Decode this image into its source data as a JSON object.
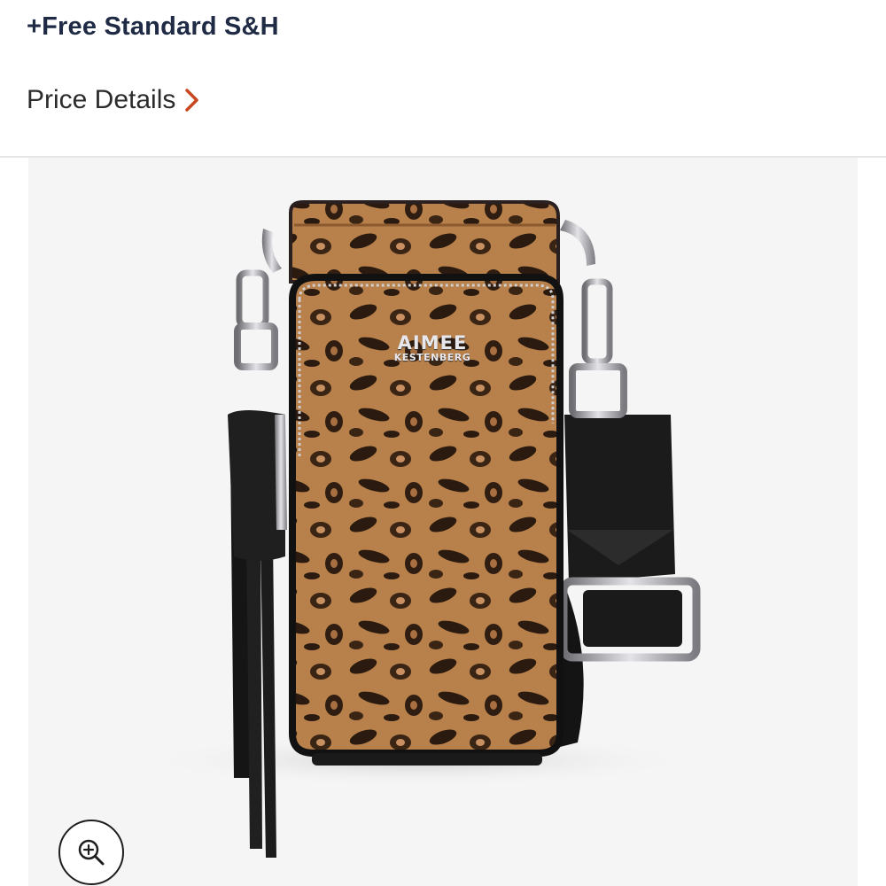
{
  "shipping": {
    "text": "+Free Standard S&H"
  },
  "price_details": {
    "label": "Price Details",
    "icon": "chevron-right-icon",
    "accent": "#c8471f"
  },
  "product_image": {
    "brand_line1": "AIMEE",
    "brand_line2": "KESTENBERG",
    "background": "#f5f5f5"
  },
  "zoom": {
    "icon": "zoom-in-icon"
  }
}
